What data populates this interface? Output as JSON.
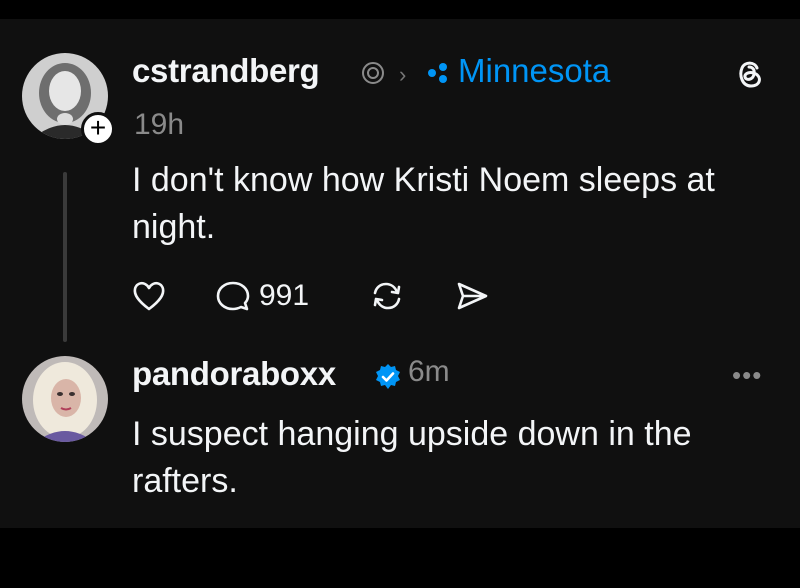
{
  "post": {
    "username": "cstrandberg",
    "community": "Minnesota",
    "time": "19h",
    "text": "I don't know how Kristi Noem sleeps at night.",
    "reply_count": "991",
    "icons": [
      "ring-icon",
      "chevron-right-icon",
      "community-icon",
      "threads-logo-icon",
      "heart-icon",
      "reply-icon",
      "repost-icon",
      "share-icon",
      "follow-plus-icon"
    ]
  },
  "reply": {
    "username": "pandoraboxx",
    "time": "6m",
    "text": "I suspect hanging upside down in the rafters.",
    "icons": [
      "verified-icon",
      "more-options-icon"
    ]
  },
  "colors": {
    "background": "#101010",
    "text": "#f3f5f7",
    "muted": "#8a8a8a",
    "accent": "#0095f6"
  }
}
